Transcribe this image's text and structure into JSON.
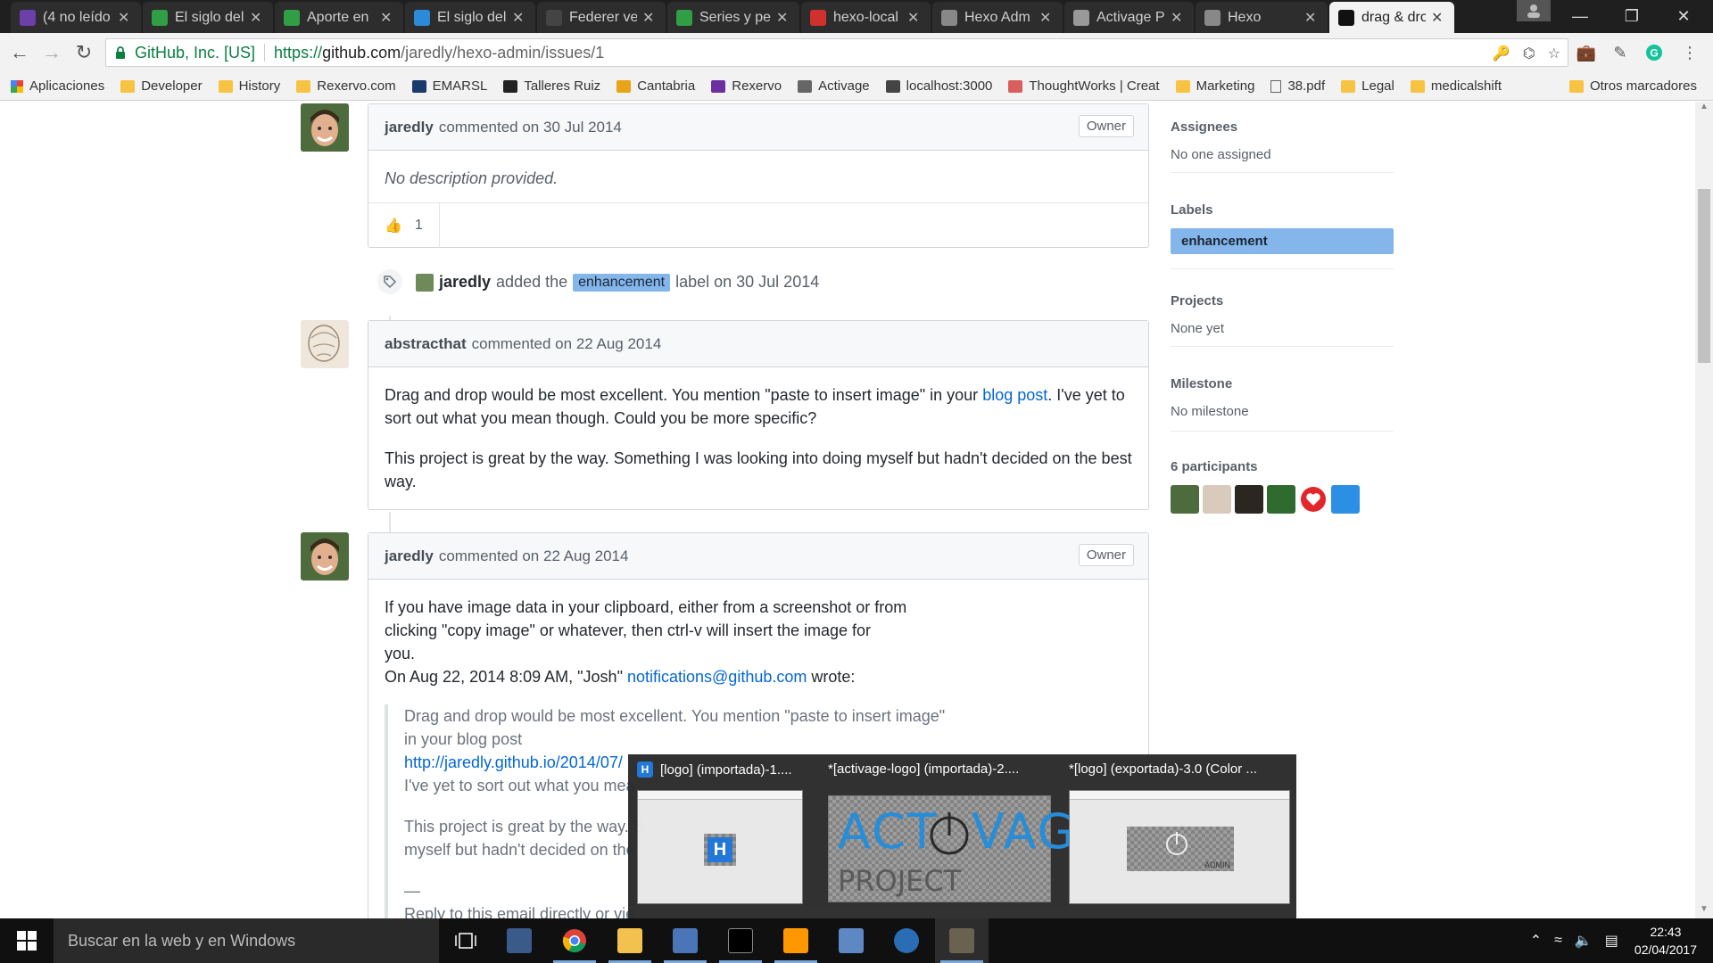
{
  "browser": {
    "tabs": [
      {
        "title": "(4 no leído",
        "icon_color": "#6d3fa8",
        "icon": "mail-icon"
      },
      {
        "title": "El siglo del",
        "icon_color": "#2f9e44",
        "icon": "p-icon"
      },
      {
        "title": "Aporte en",
        "icon_color": "#2f9e44",
        "icon": "p-icon"
      },
      {
        "title": "El siglo del",
        "icon_color": "#2b8bd8",
        "icon": "v-icon"
      },
      {
        "title": "Federer ve",
        "icon_color": "#444444",
        "icon": "e-icon"
      },
      {
        "title": "Series y pe",
        "icon_color": "#2f9e44",
        "icon": "p-icon"
      },
      {
        "title": "hexo-local",
        "icon_color": "#d0312d",
        "icon": "red-square-icon"
      },
      {
        "title": "Hexo Adm",
        "icon_color": "#888888",
        "icon": "page-icon"
      },
      {
        "title": "Activage P",
        "icon_color": "#999999",
        "icon": "page-icon"
      },
      {
        "title": "Hexo",
        "icon_color": "#888888",
        "icon": "power-icon"
      },
      {
        "title": "drag & dro",
        "icon_color": "#111111",
        "icon": "github-icon"
      }
    ],
    "address": {
      "secure_label": "GitHub, Inc. [US]",
      "scheme": "https://",
      "host": "github.com",
      "path": "/jaredly/hexo-admin/issues/1"
    },
    "bookmarks": [
      {
        "label": "Aplicaciones",
        "type": "apps"
      },
      {
        "label": "Developer",
        "type": "folder"
      },
      {
        "label": "History",
        "type": "folder"
      },
      {
        "label": "Rexervo.com",
        "type": "folder"
      },
      {
        "label": "EMARSL",
        "type": "site"
      },
      {
        "label": "Talleres Ruiz",
        "type": "site"
      },
      {
        "label": "Cantabria",
        "type": "site"
      },
      {
        "label": "Rexervo",
        "type": "site"
      },
      {
        "label": "Activage",
        "type": "site"
      },
      {
        "label": "localhost:3000",
        "type": "site"
      },
      {
        "label": "ThoughtWorks | Creat",
        "type": "site"
      },
      {
        "label": "Marketing",
        "type": "folder"
      },
      {
        "label": "38.pdf",
        "type": "file"
      },
      {
        "label": "Legal",
        "type": "folder"
      },
      {
        "label": "medicalshift",
        "type": "folder"
      }
    ],
    "other_bookmarks": "Otros marcadores"
  },
  "issue": {
    "comment1": {
      "author": "jaredly",
      "meta": "commented on 30 Jul 2014",
      "badge": "Owner",
      "body": "No description provided.",
      "reaction_count": "1"
    },
    "label_event": {
      "author": "jaredly",
      "text_before": "added the",
      "label": "enhancement",
      "text_after": "label on 30 Jul 2014"
    },
    "comment2": {
      "author": "abstracthat",
      "meta": "commented on 22 Aug 2014",
      "p1_before": "Drag and drop would be most excellent. You mention \"paste to insert image\" in your",
      "p1_link": "blog post",
      "p1_after": ". I've yet to sort out what you mean though. Could you be more specific?",
      "p2": "This project is great by the way. Something I was looking into doing myself but hadn't decided on the best way."
    },
    "comment3": {
      "author": "jaredly",
      "meta": "commented on 22 Aug 2014",
      "badge": "Owner",
      "line1": "If you have image data in your clipboard, either from a screenshot or from",
      "line2": "clicking \"copy image\" or whatever, then ctrl-v will insert the image for",
      "line3": "you.",
      "line4_before": "On Aug 22, 2014 8:09 AM, \"Josh\"",
      "line4_link": "notifications@github.com",
      "line4_after": "wrote:",
      "q1": "Drag and drop would be most excellent. You mention \"paste to insert image\"",
      "q2": "in your blog post",
      "q3_link": "http://jaredly.github.io/2014/07/",
      "q4": "I've yet to sort out what you mea",
      "q5": "This project is great by the way. S",
      "q6": "myself but hadn't decided on the",
      "q7": "—",
      "q8": "Reply to this email directly or vie"
    }
  },
  "sidebar": {
    "assignees_title": "Assignees",
    "assignees_value": "No one assigned",
    "labels_title": "Labels",
    "label": "enhancement",
    "projects_title": "Projects",
    "projects_value": "None yet",
    "milestone_title": "Milestone",
    "milestone_value": "No milestone",
    "participants_title": "6 participants"
  },
  "thumbnails": [
    {
      "title": "[logo] (importada)-1...."
    },
    {
      "title": "*[activage-logo] (importada)-2...."
    },
    {
      "title": "*[logo] (exportada)-3.0 (Color ..."
    }
  ],
  "thumb_image_text": {
    "h": "H",
    "act": "ACT",
    "vage": "VAGE",
    "project": "PROJECT",
    "admin": "ADMIN"
  },
  "taskbar": {
    "search_placeholder": "Buscar en la web y en Windows",
    "time": "22:43",
    "date": "02/04/2017"
  }
}
